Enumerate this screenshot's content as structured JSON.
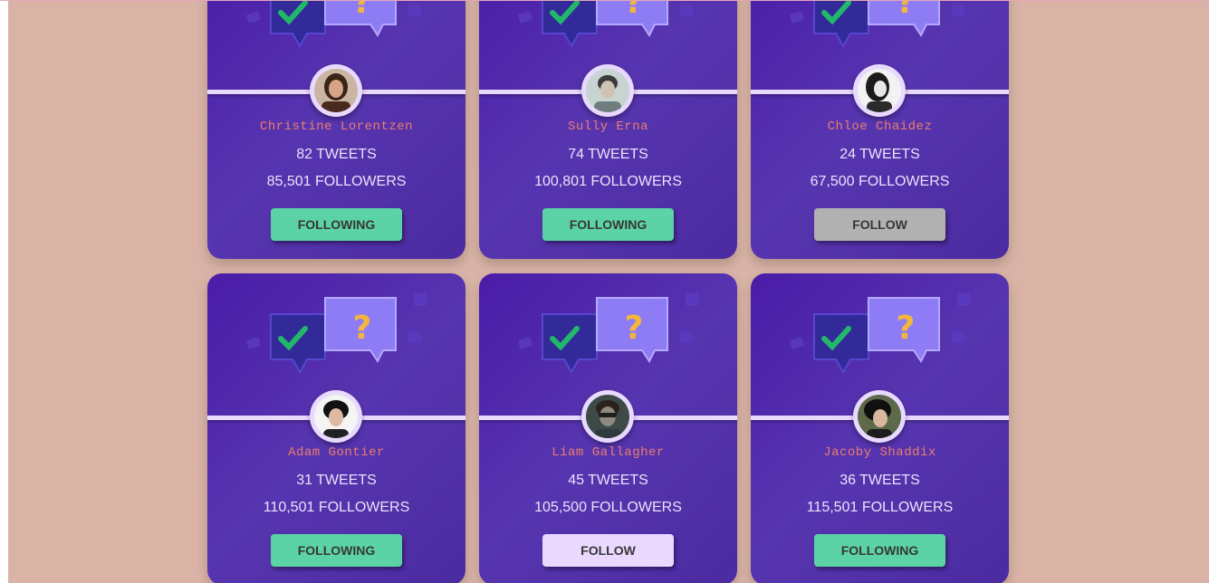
{
  "cards": [
    {
      "name": "Christine Lorentzen",
      "tweets": "82 TWEETS",
      "followers": "85,501 FOLLOWERS",
      "button": "FOLLOWING",
      "state": "following"
    },
    {
      "name": "Sully Erna",
      "tweets": "74 TWEETS",
      "followers": "100,801 FOLLOWERS",
      "button": "FOLLOWING",
      "state": "following"
    },
    {
      "name": "Chloe Chaidez",
      "tweets": "24 TWEETS",
      "followers": "67,500 FOLLOWERS",
      "button": "FOLLOW",
      "state": "follow-gray"
    },
    {
      "name": "Adam Gontier",
      "tweets": "31 TWEETS",
      "followers": "110,501 FOLLOWERS",
      "button": "FOLLOWING",
      "state": "following"
    },
    {
      "name": "Liam Gallagher",
      "tweets": "45 TWEETS",
      "followers": "105,500 FOLLOWERS",
      "button": "FOLLOW",
      "state": "follow-light"
    },
    {
      "name": "Jacoby Shaddix",
      "tweets": "36 TWEETS",
      "followers": "115,501 FOLLOWERS",
      "button": "FOLLOWING",
      "state": "following"
    }
  ],
  "colors": {
    "page_background": "#d9b3a6",
    "card_background": "#4f2bab",
    "name_color": "#ec7e6b",
    "following_button": "#5cd3a6",
    "follow_button_gray": "#b1b1b1",
    "follow_button_light": "#ebd8ff"
  },
  "icons": {
    "illustration": "chat-bubbles-check-question-icon",
    "avatar": "user-avatar-icon"
  }
}
